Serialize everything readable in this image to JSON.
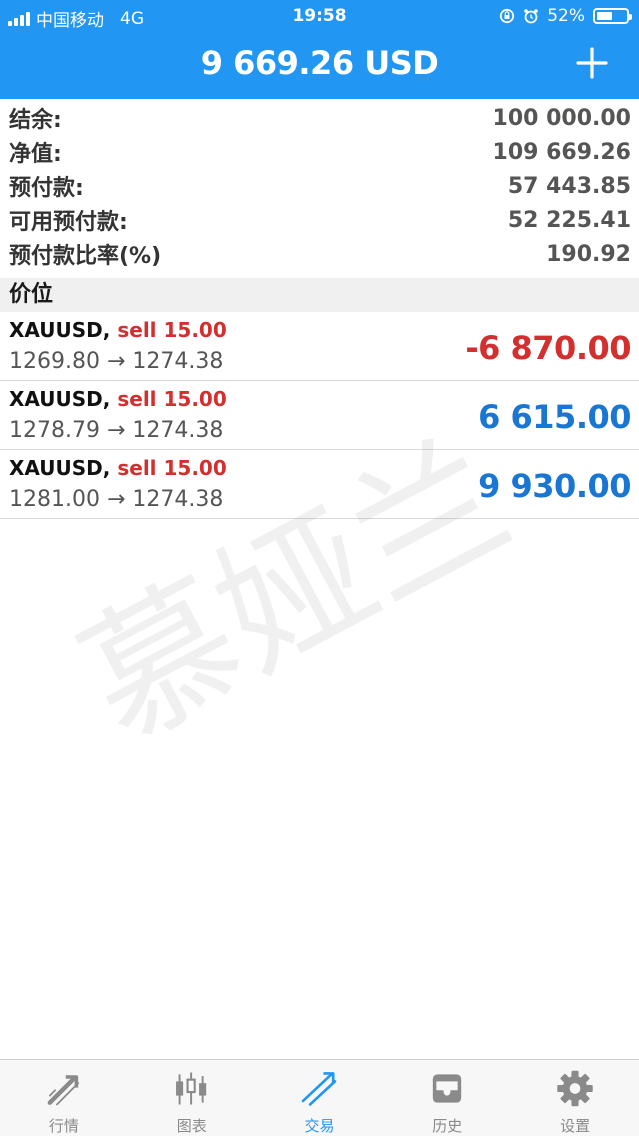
{
  "status_bar": {
    "carrier": "中国移动",
    "network": "4G",
    "time": "19:58",
    "battery_percent": "52%",
    "battery_level": 0.52
  },
  "header": {
    "title": "9 669.26 USD"
  },
  "summary": [
    {
      "label": "结余:",
      "value": "100 000.00"
    },
    {
      "label": "净值:",
      "value": "109 669.26"
    },
    {
      "label": "预付款:",
      "value": "57 443.85"
    },
    {
      "label": "可用预付款:",
      "value": "52 225.41"
    },
    {
      "label": "预付款比率(%)",
      "value": "190.92"
    }
  ],
  "section": {
    "title": "价位"
  },
  "positions": [
    {
      "symbol": "XAUUSD,",
      "side": "sell 15.00",
      "prices": "1269.80 → 1274.38",
      "profit": "-6 870.00"
    },
    {
      "symbol": "XAUUSD,",
      "side": "sell 15.00",
      "prices": "1278.79 → 1274.38",
      "profit": "6 615.00"
    },
    {
      "symbol": "XAUUSD,",
      "side": "sell 15.00",
      "prices": "1281.00 → 1274.38",
      "profit": "9 930.00"
    }
  ],
  "watermark": "慕娅兰",
  "tabs": [
    {
      "label": "行情",
      "icon": "quotes-icon",
      "active": false
    },
    {
      "label": "图表",
      "icon": "chart-icon",
      "active": false
    },
    {
      "label": "交易",
      "icon": "trade-icon",
      "active": true
    },
    {
      "label": "历史",
      "icon": "history-icon",
      "active": false
    },
    {
      "label": "设置",
      "icon": "settings-icon",
      "active": false
    }
  ],
  "colors": {
    "brand_blue": "#2196F3",
    "loss_red": "#D32F2F",
    "profit_blue": "#1976D2",
    "tab_inactive": "#8A8A8A"
  }
}
